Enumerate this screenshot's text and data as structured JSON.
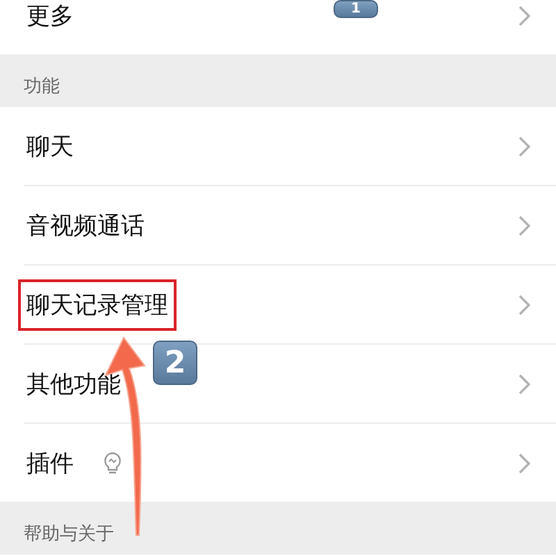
{
  "sections": [
    {
      "items": [
        {
          "label": "更多",
          "kind": "plain",
          "highlighted": false
        }
      ]
    },
    {
      "header": "功能",
      "items": [
        {
          "label": "聊天",
          "kind": "plain",
          "highlighted": false
        },
        {
          "label": "音视频通话",
          "kind": "plain",
          "highlighted": false
        },
        {
          "label": "聊天记录管理",
          "kind": "plain",
          "highlighted": true
        },
        {
          "label": "其他功能",
          "kind": "plain",
          "highlighted": false
        },
        {
          "label": "插件",
          "kind": "bulb",
          "highlighted": false
        }
      ]
    },
    {
      "header": "帮助与关于"
    }
  ],
  "step_badges": [
    {
      "text": "1"
    },
    {
      "text": "2"
    }
  ]
}
